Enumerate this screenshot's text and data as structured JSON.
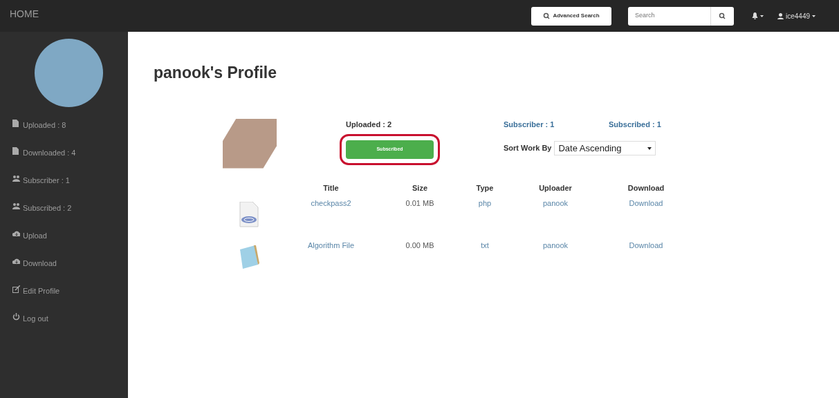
{
  "navbar": {
    "brand": "HOME",
    "advanced_search": "Advanced Search",
    "search": {
      "placeholder": "Search"
    },
    "user": "ice4449"
  },
  "sidebar": {
    "items": [
      {
        "kind": "file",
        "label": "Uploaded : 8"
      },
      {
        "kind": "file",
        "label": "Downloaded : 4"
      },
      {
        "kind": "users",
        "label": "Subscriber : 1"
      },
      {
        "kind": "users",
        "label": "Subscribed : 2"
      },
      {
        "kind": "cloud",
        "label": "Upload"
      },
      {
        "kind": "cloud",
        "label": "Download"
      },
      {
        "kind": "edit",
        "label": "Edit Profile"
      },
      {
        "kind": "power",
        "label": "Log out"
      }
    ]
  },
  "profile": {
    "title": "panook's Profile",
    "uploaded": "Uploaded : 2",
    "subscriber": "Subscriber : 1",
    "subscribed": "Subscribed : 1",
    "button": {
      "label": "Subscribed",
      "highlighted": true
    },
    "sort": {
      "label": "Sort Work By",
      "value": "Date Ascending"
    }
  },
  "table": {
    "columns": [
      "Title",
      "Size",
      "Type",
      "Uploader",
      "Download"
    ],
    "rows": [
      {
        "kind": "php",
        "title": "checkpass2",
        "size": "0.01 MB",
        "type": "php",
        "uploader": "panook",
        "download": "Download"
      },
      {
        "kind": "txt",
        "title": "Algorithm File",
        "size": "0.00 MB",
        "type": "txt",
        "uploader": "panook",
        "download": "Download"
      }
    ]
  }
}
